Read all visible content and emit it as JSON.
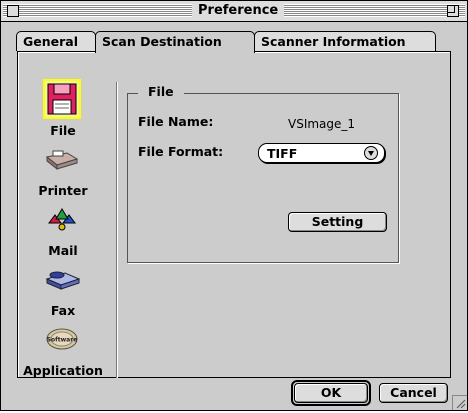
{
  "window": {
    "title": "Preference"
  },
  "tabs": [
    {
      "label": "General"
    },
    {
      "label": "Scan Destination"
    },
    {
      "label": "Scanner Information"
    }
  ],
  "destinations": [
    {
      "label": "File",
      "icon": "floppy-disk-icon",
      "selected": true
    },
    {
      "label": "Printer",
      "icon": "printer-icon",
      "selected": false
    },
    {
      "label": "Mail",
      "icon": "mail-icon",
      "selected": false
    },
    {
      "label": "Fax",
      "icon": "fax-icon",
      "selected": false
    },
    {
      "label": "Application",
      "icon": "software-cd-icon",
      "selected": false,
      "icon_text": "Software"
    }
  ],
  "file_group": {
    "title": "File",
    "file_name_label": "File Name:",
    "file_name_value": "VSImage_1",
    "file_format_label": "File Format:",
    "file_format_value": "TIFF",
    "setting_button": "Setting"
  },
  "footer": {
    "ok_label": "OK",
    "cancel_label": "Cancel"
  },
  "colors": {
    "selection_highlight": "#ffff00",
    "floppy": "#e02060"
  }
}
